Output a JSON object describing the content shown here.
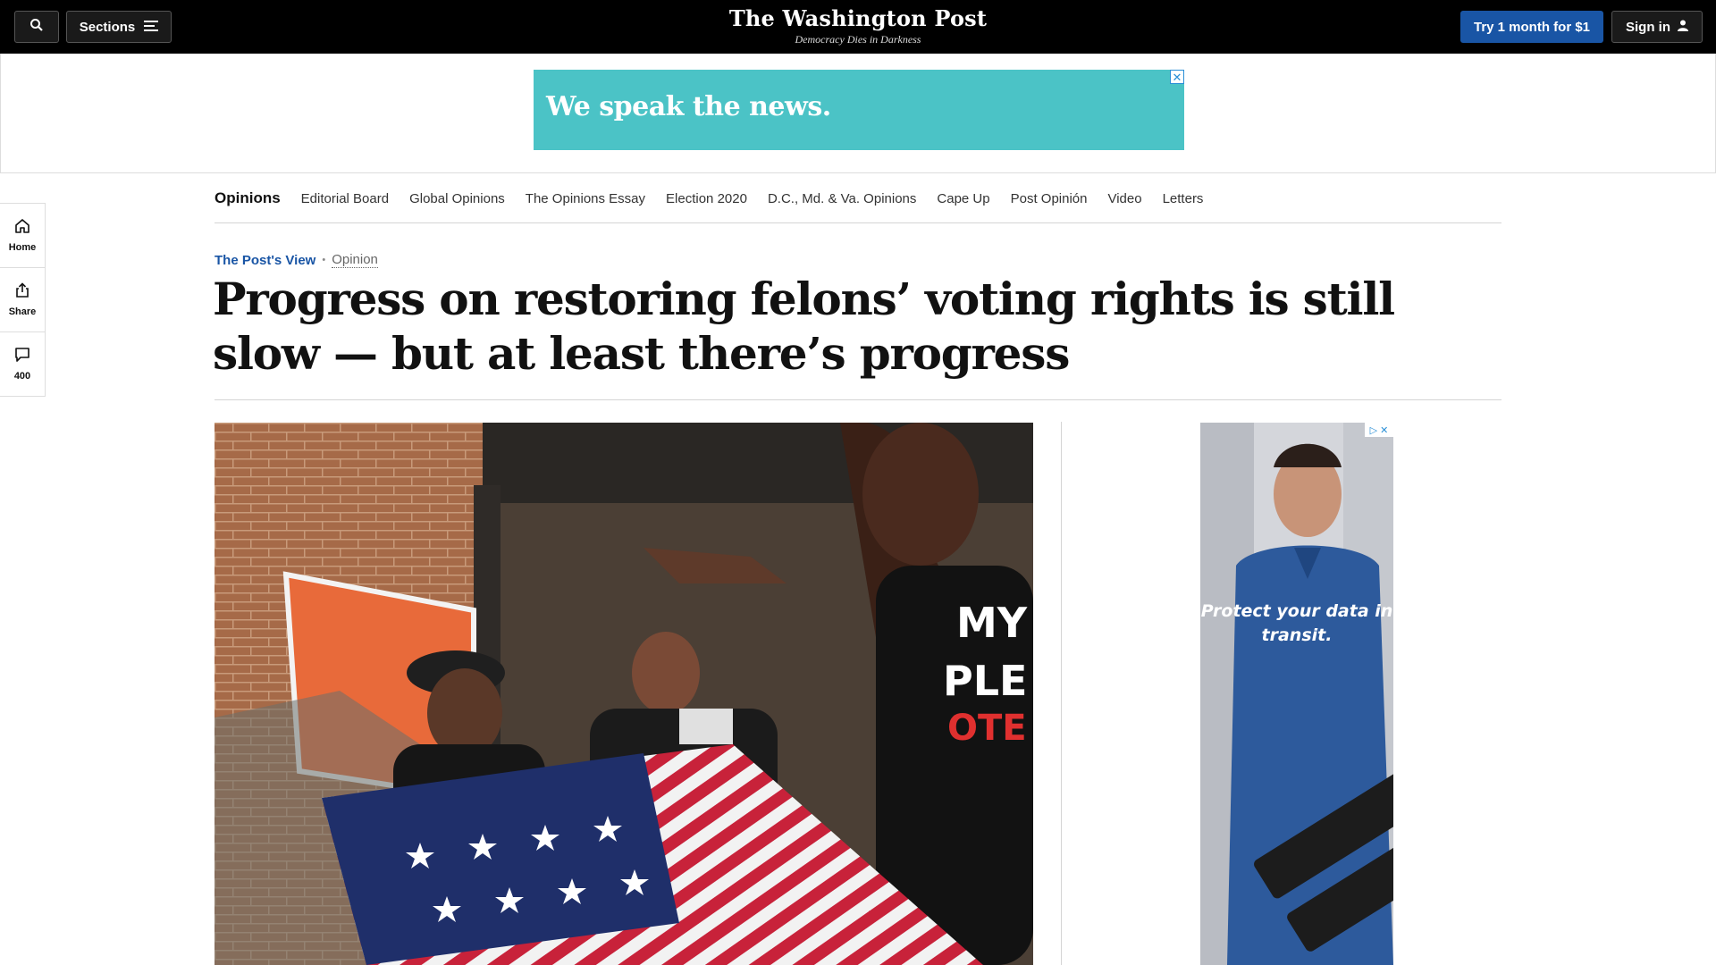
{
  "topbar": {
    "search_icon": "search-icon",
    "sections_label": "Sections",
    "sections_icon": "menu-icon",
    "logo": "The Washington Post",
    "tagline": "Democracy Dies in Darkness",
    "subscribe_label": "Try 1 month for $1",
    "signin_label": "Sign in",
    "signin_icon": "user-icon"
  },
  "leader_ad": {
    "text": "We speak the news.",
    "background": "#4bc3c6",
    "close_icon": "close-icon"
  },
  "section_nav": {
    "items": [
      {
        "label": "Opinions",
        "active": true
      },
      {
        "label": "Editorial Board"
      },
      {
        "label": "Global Opinions"
      },
      {
        "label": "The Opinions Essay"
      },
      {
        "label": "Election 2020"
      },
      {
        "label": "D.C., Md. & Va. Opinions"
      },
      {
        "label": "Cape Up"
      },
      {
        "label": "Post Opinión"
      },
      {
        "label": "Video"
      },
      {
        "label": "Letters"
      }
    ]
  },
  "left_rail": {
    "home_label": "Home",
    "home_icon": "home-icon",
    "share_label": "Share",
    "share_icon": "share-icon",
    "comments_count": "400",
    "comments_icon": "comment-icon"
  },
  "article": {
    "kicker_label": "The Post's View",
    "kicker_separator": "•",
    "kicker_section": "Opinion",
    "headline": "Progress on restoring felons’ voting rights is still slow — but at least there’s progress",
    "accent_color": "#1955a5"
  },
  "side_ad": {
    "text": "Protect your data in transit.",
    "adchoice_icon": "adchoices-icon"
  }
}
